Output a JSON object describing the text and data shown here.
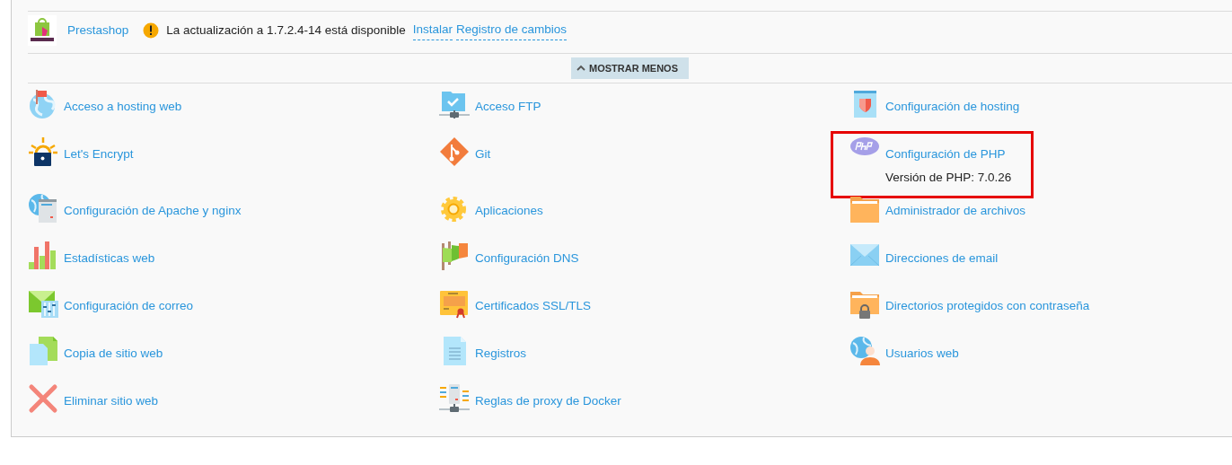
{
  "app": {
    "name": "Prestashop",
    "update_message": "La actualización a 1.7.2.4-14 está disponible",
    "links": [
      "Instalar",
      "Registro de cambios"
    ]
  },
  "toggle_button": {
    "label": "MOSTRAR MENOS"
  },
  "tools": [
    {
      "label": "Acceso a hosting web"
    },
    {
      "label": "Acceso FTP"
    },
    {
      "label": "Configuración de hosting"
    },
    {
      "label": "Let's Encrypt"
    },
    {
      "label": "Git"
    },
    {
      "label": "Configuración de PHP",
      "detail": "Versión de PHP: 7.0.26",
      "highlighted": true
    },
    {
      "label": "Configuración de Apache y nginx"
    },
    {
      "label": "Aplicaciones"
    },
    {
      "label": "Administrador de archivos"
    },
    {
      "label": "Estadísticas web"
    },
    {
      "label": "Configuración DNS"
    },
    {
      "label": "Direcciones de email"
    },
    {
      "label": "Configuración de correo"
    },
    {
      "label": "Certificados SSL/TLS"
    },
    {
      "label": "Directorios protegidos con contraseña"
    },
    {
      "label": "Copia de sitio web"
    },
    {
      "label": "Registros"
    },
    {
      "label": "Usuarios web"
    },
    {
      "label": "Eliminar sitio web"
    },
    {
      "label": "Reglas de proxy de Docker"
    }
  ]
}
